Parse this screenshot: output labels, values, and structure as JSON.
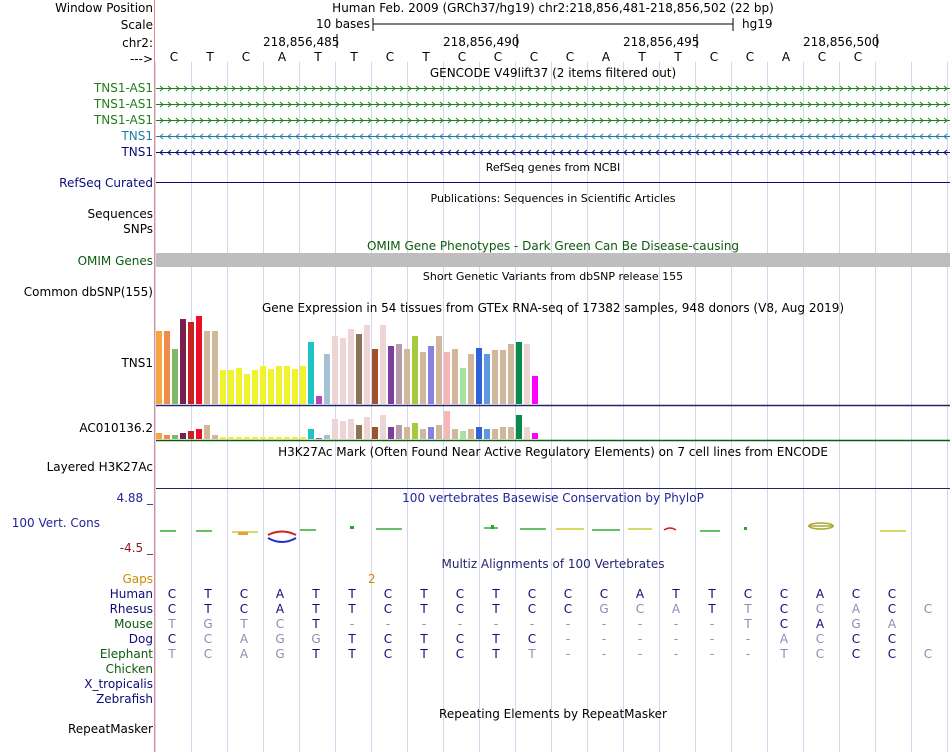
{
  "header": {
    "window_position_label": "Window Position",
    "window_position_value": "Human Feb. 2009 (GRCh37/hg19)   chr2:218,856,481-218,856,502 (22 bp)",
    "scale_label": "Scale",
    "scale_value": "10 bases",
    "scale_assembly": "hg19",
    "chrom_label": "chr2:",
    "strand_label": "--->",
    "ruler_ticks": [
      "218,856,485",
      "218,856,490",
      "218,856,495",
      "218,856,500"
    ],
    "sequence": [
      "C",
      "T",
      "C",
      "A",
      "T",
      "T",
      "C",
      "T",
      "C",
      "C",
      "C",
      "C",
      "A",
      "T",
      "T",
      "C",
      "C",
      "A",
      "C",
      "C"
    ]
  },
  "gencode": {
    "title": "GENCODE V49lift37 (2 items filtered out)",
    "tracks": [
      {
        "label": "TNS1-AS1",
        "color": "#1e7f1e",
        "direction": "right"
      },
      {
        "label": "TNS1-AS1",
        "color": "#1e7f1e",
        "direction": "right"
      },
      {
        "label": "TNS1-AS1",
        "color": "#1e7f1e",
        "direction": "right"
      },
      {
        "label": "TNS1",
        "color": "#1a7fa8",
        "direction": "left"
      },
      {
        "label": "TNS1",
        "color": "#0c0c78",
        "direction": "left"
      }
    ]
  },
  "refseq": {
    "title": "RefSeq genes from NCBI",
    "label": "RefSeq Curated"
  },
  "publications": {
    "title": "Publications: Sequences in Scientific Articles",
    "label1": "Sequences",
    "label2": "SNPs"
  },
  "omim": {
    "title": "OMIM Gene Phenotypes - Dark Green Can Be Disease-causing",
    "label": "OMIM Genes"
  },
  "dbsnp": {
    "title": "Short Genetic Variants from dbSNP release 155",
    "label": "Common dbSNP(155)"
  },
  "gtex": {
    "title": "Gene Expression in 54 tissues from GTEx RNA-seq of 17382 samples, 948 donors (V8, Aug 2019)",
    "label_tns1": "TNS1",
    "label_ac": "AC010136.2",
    "colors": [
      "#f5a63e",
      "#f08c4a",
      "#7fb86b",
      "#7b1f4f",
      "#c92222",
      "#ee0e2a",
      "#d2b89a",
      "#d2b89a",
      "#f1f12c",
      "#f1f12c",
      "#f1f12c",
      "#f1f12c",
      "#f1f12c",
      "#f1f12c",
      "#f1f12c",
      "#f1f12c",
      "#f1f12c",
      "#f1f12c",
      "#f1f12c",
      "#1ec3c3",
      "#bb44bb",
      "#a6c1d5",
      "#eed5d5",
      "#eed5d5",
      "#eed5d5",
      "#8b7355",
      "#eed5d5",
      "#a0522d",
      "#eed5d5",
      "#7d3e9e",
      "#b89aaa",
      "#d2b89a",
      "#a7c940",
      "#d2b89a",
      "#8a80e0",
      "#d2b89a",
      "#f7b6b6",
      "#d2b89a",
      "#a6e39e",
      "#d2b89a",
      "#2e64d6",
      "#5f99e0",
      "#d2b89a",
      "#d2b89a",
      "#d2b89a",
      "#0a8a4a",
      "#eed5d5",
      "#ff00ff"
    ],
    "tns1_values": [
      73,
      73,
      55,
      85,
      82,
      88,
      73,
      73,
      34,
      34,
      36,
      30,
      34,
      38,
      35,
      38,
      38,
      35,
      38,
      62,
      8,
      50,
      68,
      66,
      75,
      70,
      79,
      55,
      79,
      58,
      60,
      55,
      68,
      52,
      58,
      68,
      52,
      55,
      36,
      50,
      56,
      50,
      54,
      54,
      60,
      62,
      60,
      28
    ],
    "ac_values": [
      6,
      4,
      4,
      6,
      8,
      10,
      14,
      4,
      2,
      2,
      2,
      2,
      2,
      2,
      2,
      2,
      2,
      2,
      2,
      10,
      1,
      4,
      20,
      18,
      20,
      14,
      22,
      12,
      24,
      12,
      14,
      12,
      16,
      10,
      12,
      14,
      28,
      10,
      8,
      10,
      12,
      10,
      10,
      12,
      12,
      24,
      12,
      6
    ]
  },
  "h3k27ac": {
    "title": "H3K27Ac Mark (Often Found Near Active Regulatory Elements) on 7 cell lines from ENCODE",
    "label": "Layered H3K27Ac"
  },
  "phylop": {
    "title": "100 vertebrates Basewise Conservation by PhyloP",
    "label": "100 Vert. Cons",
    "ymax": "4.88 _",
    "ymin": "-4.5 _"
  },
  "multiz": {
    "title": "Multiz Alignments of 100 Vertebrates",
    "gaps_label": "Gaps",
    "gap_marker": "2",
    "species": [
      {
        "name": "Human",
        "seq": [
          "C",
          "T",
          "C",
          "A",
          "T",
          "T",
          "C",
          "T",
          "C",
          "T",
          "C",
          "C",
          "C",
          "A",
          "T",
          "T",
          "C",
          "C",
          "A",
          "C",
          "C"
        ]
      },
      {
        "name": "Rhesus",
        "seq": [
          "C",
          "T",
          "C",
          "A",
          "T",
          "T",
          "C",
          "T",
          "C",
          "T",
          "C",
          "C",
          "G",
          "C",
          "A",
          "T",
          "T",
          "C",
          "C",
          "A",
          "C",
          "C"
        ]
      },
      {
        "name": "Mouse",
        "seq": [
          "T",
          "G",
          "T",
          "C",
          "T",
          "-",
          "-",
          "-",
          "-",
          "-",
          "-",
          "-",
          "-",
          "-",
          "-",
          "-",
          "T",
          "C",
          "A",
          "G",
          "A"
        ]
      },
      {
        "name": "Dog",
        "seq": [
          "C",
          "C",
          "A",
          "G",
          "G",
          "T",
          "C",
          "T",
          "C",
          "T",
          "C",
          "-",
          "-",
          "-",
          "-",
          "-",
          "-",
          "A",
          "C",
          "C",
          "C"
        ]
      },
      {
        "name": "Elephant",
        "seq": [
          "T",
          "C",
          "A",
          "G",
          "T",
          "T",
          "C",
          "T",
          "C",
          "T",
          "T",
          "-",
          "-",
          "-",
          "-",
          "-",
          "-",
          "T",
          "C",
          "C",
          "C",
          "C"
        ]
      },
      {
        "name": "Chicken",
        "seq": []
      },
      {
        "name": "X_tropicalis",
        "seq": []
      },
      {
        "name": "Zebrafish",
        "seq": []
      }
    ]
  },
  "repeatmasker": {
    "title": "Repeating Elements by RepeatMasker",
    "label": "RepeatMasker"
  }
}
